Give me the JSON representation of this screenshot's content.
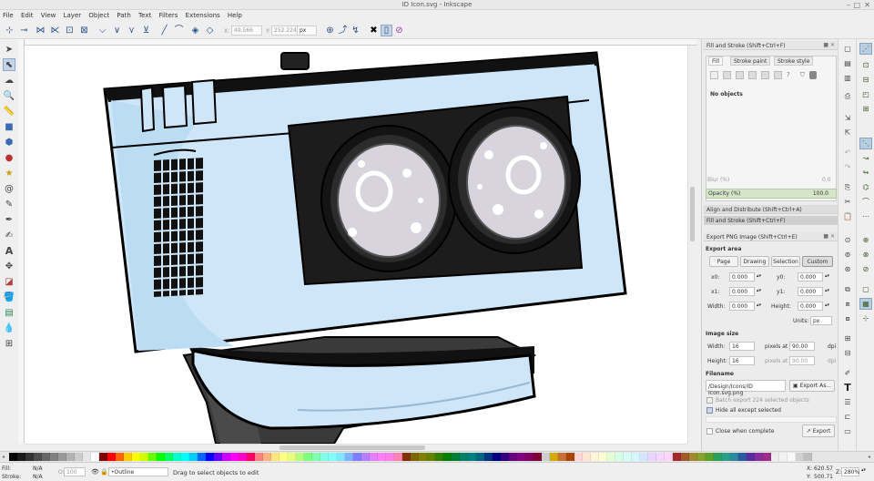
{
  "window": {
    "title": "ID Icon.svg - Inkscape"
  },
  "menu": [
    "File",
    "Edit",
    "View",
    "Layer",
    "Object",
    "Path",
    "Text",
    "Filters",
    "Extensions",
    "Help"
  ],
  "controls": {
    "x_value": "49.566",
    "w_value": "252.224",
    "unit": "px"
  },
  "fill_stroke_panel": {
    "title": "Fill and Stroke (Shift+Ctrl+F)",
    "tabs": [
      "Fill",
      "Stroke paint",
      "Stroke style"
    ],
    "status": "No objects",
    "paint_icons": [
      "?",
      "unset-icon"
    ],
    "blur_label": "Blur (%)",
    "blur_value": "0.0",
    "opacity_label": "Opacity (%)",
    "opacity_value": "100.0"
  },
  "collapsed_panels": [
    "Align and Distribute (Shift+Ctrl+A)",
    "Fill and Stroke (Shift+Ctrl+F)"
  ],
  "export_panel": {
    "title": "Export PNG Image (Shift+Ctrl+E)",
    "area_heading": "Export area",
    "area_buttons": [
      "Page",
      "Drawing",
      "Selection",
      "Custom"
    ],
    "active_area": "Custom",
    "x0_label": "x0:",
    "x0": "0.000",
    "y0_label": "y0:",
    "y0": "0.000",
    "x1_label": "x1:",
    "x1": "0.000",
    "y1_label": "y1:",
    "y1": "0.000",
    "width_label": "Width:",
    "width": "0.000",
    "height_label": "Height:",
    "height": "0.000",
    "units_label": "Units:",
    "units": "px",
    "image_heading": "Image size",
    "img_width_label": "Width:",
    "img_width": "16",
    "img_height_label": "Height:",
    "img_height": "16",
    "pixels_at": "pixels at",
    "dpi_value": "90.00",
    "dpi_value2": "90.00",
    "dpi_unit": "dpi",
    "filename_heading": "Filename",
    "filename": "/Design/Icons/ID Icon.svg.png",
    "export_as": "Export As...",
    "batch_label": "Batch export 224 selected objects",
    "hide_label": "Hide all except selected",
    "close_label": "Close when complete",
    "export_button": "Export"
  },
  "status": {
    "fill_label": "Fill:",
    "fill_value": "N/A",
    "stroke_label": "Stroke:",
    "stroke_value": "N/A",
    "opacity_label": "O:",
    "opacity_value": "100",
    "layer": "•Outline",
    "message": "Drag to select objects to edit",
    "x_label": "X:",
    "x_value": "620.57",
    "y_label": "Y:",
    "y_value": "500.71",
    "zoom_label": "Z:",
    "zoom_value": "280%"
  },
  "palette_colors": [
    "#000000",
    "#1a1a1a",
    "#333333",
    "#4d4d4d",
    "#666666",
    "#808080",
    "#999999",
    "#b3b3b3",
    "#cccccc",
    "#e6e6e6",
    "#ffffff",
    "#800000",
    "#ff0000",
    "#ff6600",
    "#ffcc00",
    "#ffff00",
    "#ccff00",
    "#66ff00",
    "#00ff00",
    "#00ff66",
    "#00ffcc",
    "#00ffff",
    "#00ccff",
    "#0066ff",
    "#0000ff",
    "#6600ff",
    "#cc00ff",
    "#ff00ff",
    "#ff00cc",
    "#ff0066",
    "#ff8080",
    "#ffb380",
    "#ffe680",
    "#ffff80",
    "#e6ff80",
    "#b3ff80",
    "#80ff80",
    "#80ffb3",
    "#80ffe6",
    "#80ffff",
    "#80e6ff",
    "#80b3ff",
    "#8080ff",
    "#b380ff",
    "#e680ff",
    "#ff80ff",
    "#ff80e6",
    "#ff80b3",
    "#803300",
    "#806600",
    "#808000",
    "#668000",
    "#338000",
    "#008000",
    "#008033",
    "#008066",
    "#008080",
    "#006680",
    "#003380",
    "#000080",
    "#330080",
    "#660080",
    "#800080",
    "#800066",
    "#800033",
    "#cccccc",
    "#d4aa00",
    "#c87137",
    "#aa4400",
    "#ffd5d5",
    "#ffe6d5",
    "#fff6d5",
    "#ffffd5",
    "#e5ffd5",
    "#d5ffe6",
    "#d5fff6",
    "#d5f6ff",
    "#d5e5ff",
    "#e5d5ff",
    "#f6d5ff",
    "#ffd5f6",
    "#a02c2c",
    "#a05a2c",
    "#a0892c",
    "#89a02c",
    "#5aa02c",
    "#2ca05a",
    "#2ca089",
    "#2c89a0",
    "#2c5aa0",
    "#5a2ca0",
    "#892ca0",
    "#a02c89",
    "#ececec",
    "#f2f2f2",
    "#f9f9f9",
    "#d0d0d0",
    "#bfbfbf"
  ]
}
